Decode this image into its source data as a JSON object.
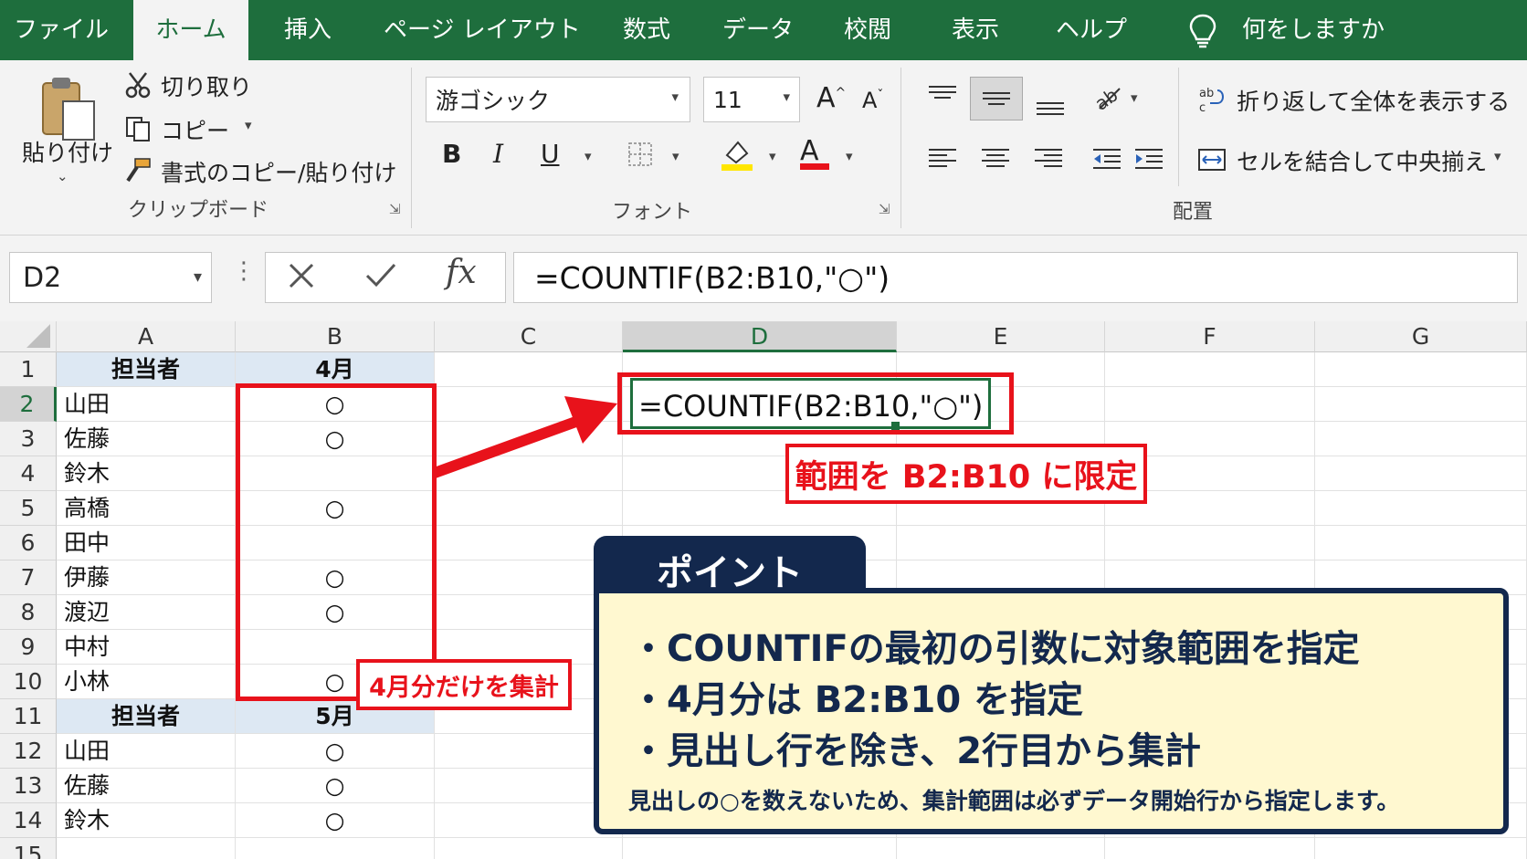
{
  "tabs": [
    {
      "label": "ファイル",
      "active": false
    },
    {
      "label": "ホーム",
      "active": true
    },
    {
      "label": "挿入",
      "active": false
    },
    {
      "label": "ページ レイアウト",
      "active": false
    },
    {
      "label": "数式",
      "active": false
    },
    {
      "label": "データ",
      "active": false
    },
    {
      "label": "校閲",
      "active": false
    },
    {
      "label": "表示",
      "active": false
    },
    {
      "label": "ヘルプ",
      "active": false
    }
  ],
  "tell_me": "何をしますか",
  "ribbon": {
    "clipboard": {
      "paste": "貼り付け",
      "cut": "切り取り",
      "copy": "コピー",
      "format_painter": "書式のコピー/貼り付け",
      "group_label": "クリップボード"
    },
    "font": {
      "font_name": "游ゴシック",
      "font_size": "11",
      "grow": "A",
      "shrink": "A",
      "bold": "B",
      "italic": "I",
      "underline": "U",
      "font_color_letter": "A",
      "group_label": "フォント"
    },
    "alignment": {
      "wrap_text": "折り返して全体を表示する",
      "merge_center": "セルを結合して中央揃え",
      "group_label": "配置"
    }
  },
  "formula_bar": {
    "name_box": "D2",
    "fx": "fx",
    "formula": "=COUNTIF(B2:B10,\"○\")"
  },
  "columns": [
    "A",
    "B",
    "C",
    "D",
    "E",
    "F",
    "G"
  ],
  "rows": [
    {
      "num": "1",
      "a": "担当者",
      "b": "4月",
      "header": true
    },
    {
      "num": "2",
      "a": "山田",
      "b": "○"
    },
    {
      "num": "3",
      "a": "佐藤",
      "b": "○"
    },
    {
      "num": "4",
      "a": "鈴木",
      "b": ""
    },
    {
      "num": "5",
      "a": "高橋",
      "b": "○"
    },
    {
      "num": "6",
      "a": "田中",
      "b": ""
    },
    {
      "num": "7",
      "a": "伊藤",
      "b": "○"
    },
    {
      "num": "8",
      "a": "渡辺",
      "b": "○"
    },
    {
      "num": "9",
      "a": "中村",
      "b": ""
    },
    {
      "num": "10",
      "a": "小林",
      "b": "○"
    },
    {
      "num": "11",
      "a": "担当者",
      "b": "5月",
      "header": true
    },
    {
      "num": "12",
      "a": "山田",
      "b": "○"
    },
    {
      "num": "13",
      "a": "佐藤",
      "b": "○"
    },
    {
      "num": "14",
      "a": "鈴木",
      "b": "○"
    },
    {
      "num": "15",
      "a": "",
      "b": ""
    }
  ],
  "active_cell_formula": "=COUNTIF(B2:B10,\"○\")",
  "annotations": {
    "range_label": "範囲を B2:B10 に限定",
    "april_label": "4月分だけを集計"
  },
  "point": {
    "title": "ポイント",
    "bullets": [
      "・COUNTIFの最初の引数に対象範囲を指定",
      "・4月分は B2:B10 を指定",
      "・見出し行を除き、2行目から集計"
    ],
    "note": "見出しの○を数えないため、集計範囲は必ずデータ開始行から指定します。"
  },
  "colors": {
    "excel_green": "#1e6e3d",
    "annotation_red": "#e8121b",
    "point_navy": "#13284d",
    "point_bg": "#fff8d0",
    "header_fill": "#dde8f3"
  }
}
